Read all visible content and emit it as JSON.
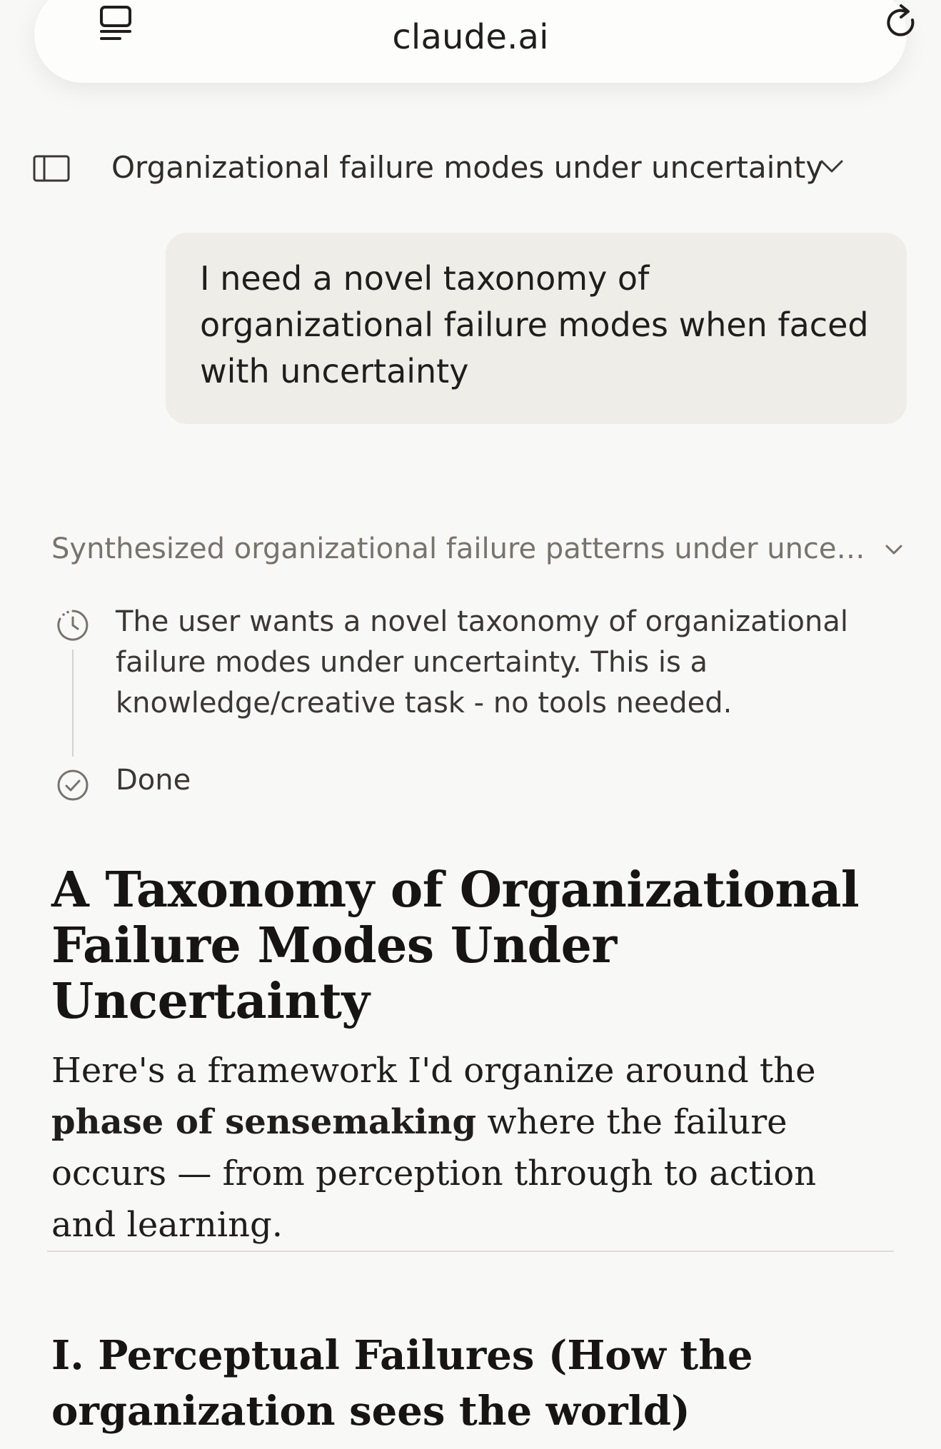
{
  "browser": {
    "url": "claude.ai",
    "tabs_icon": "tabs-icon",
    "reload_icon": "reload-icon"
  },
  "conversation": {
    "sidebar_icon": "sidebar-icon",
    "title": "Organizational failure modes under uncertainty",
    "chevron_icon": "chevron-down-icon"
  },
  "user_message": {
    "text": "I need a novel taxonomy of organizational failure modes when faced with uncertainty"
  },
  "thinking": {
    "summary": "Synthesized organizational failure patterns under uncertainty",
    "step_text": "The user wants a novel taxonomy of organizational failure modes under uncertainty. This is a knowledge/creative task - no tools needed.",
    "done_label": "Done",
    "step_icon": "clock-icon",
    "done_icon": "check-circle-icon"
  },
  "response": {
    "heading": "A Taxonomy of Organizational Failure Modes Under Uncertainty",
    "intro_part1": "Here's a framework I'd organize around the ",
    "intro_bold": "phase of sensemaking",
    "intro_part2": " where the failure occurs — from perception through to action and learning.",
    "section1_heading": "I. Perceptual Failures (How the organization sees the world)"
  }
}
